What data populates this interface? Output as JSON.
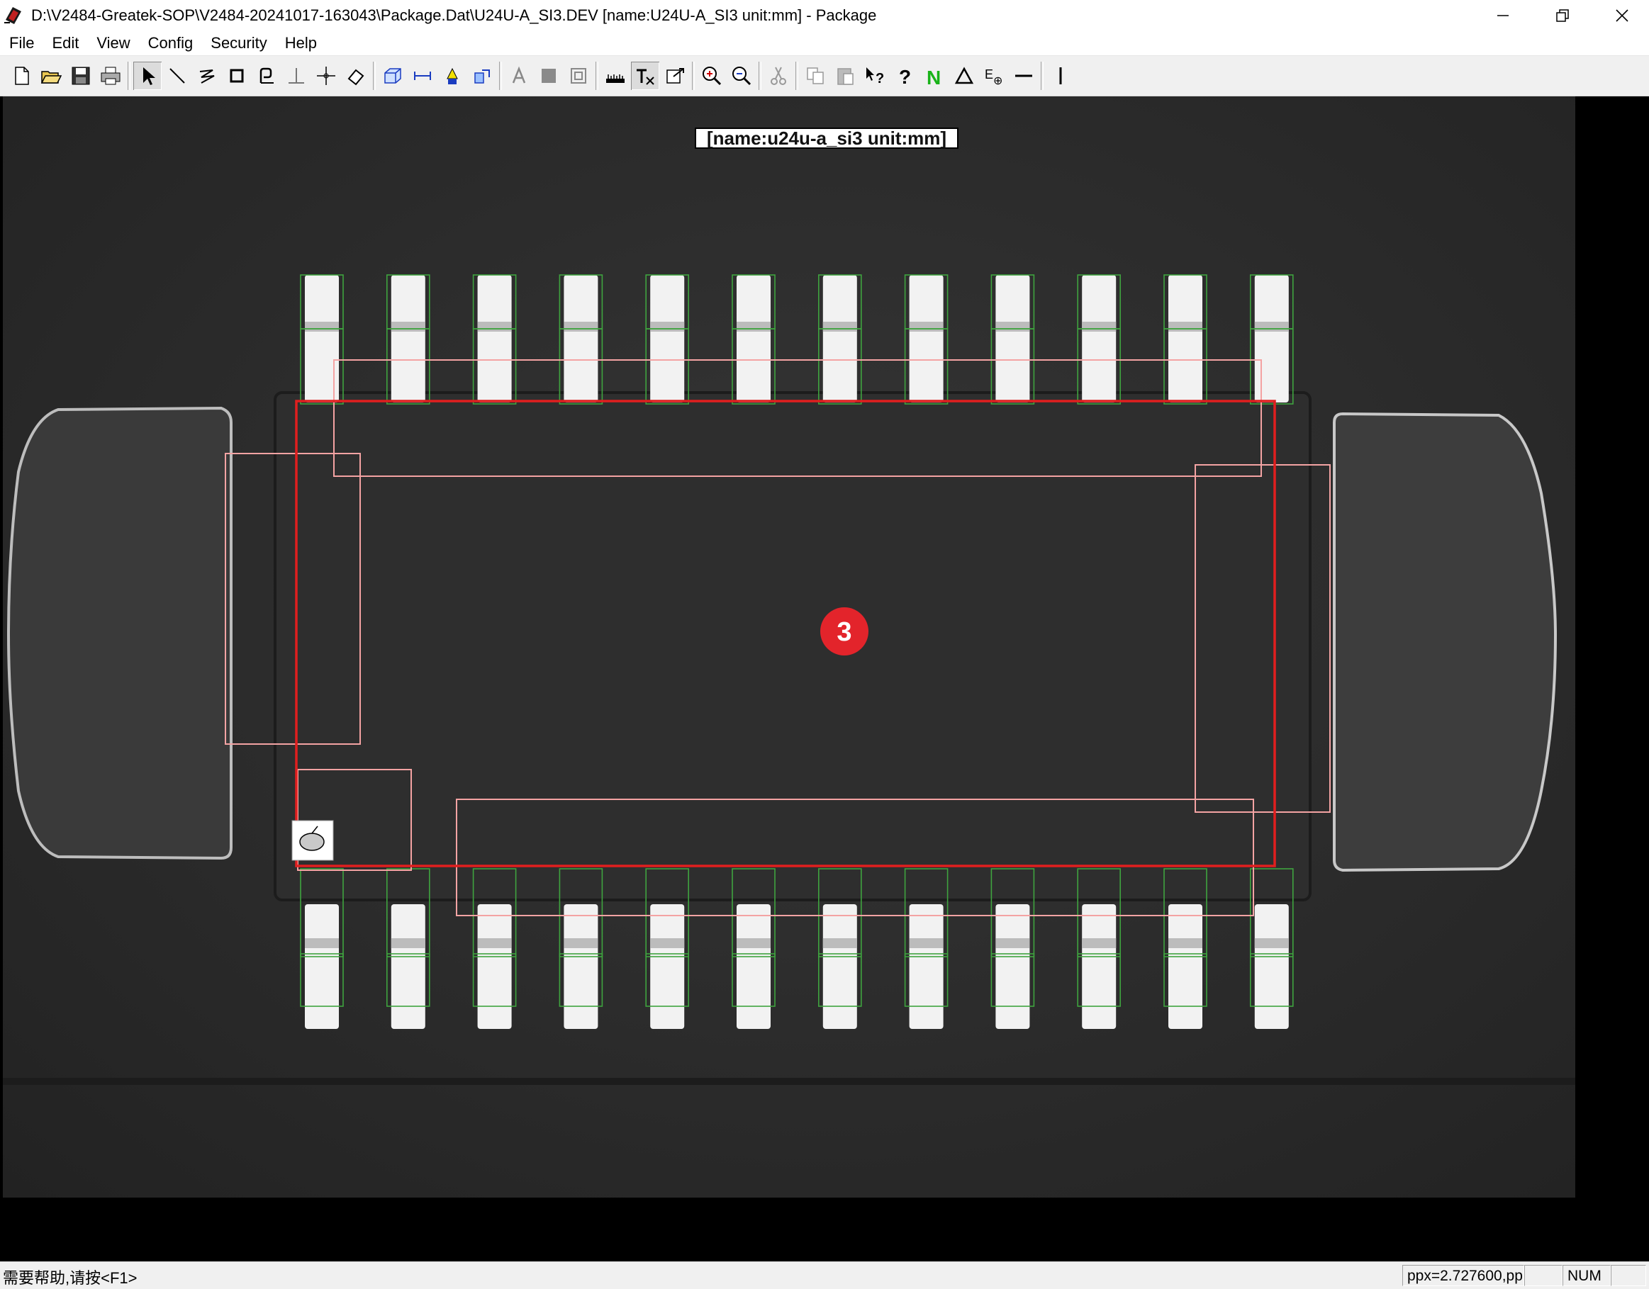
{
  "window": {
    "title": "D:\\V2484-Greatek-SOP\\V2484-20241017-163043\\Package.Dat\\U24U-A_SI3.DEV [name:U24U-A_SI3 unit:mm] - Package"
  },
  "menu": [
    "File",
    "Edit",
    "View",
    "Config",
    "Security",
    "Help"
  ],
  "toolbar": {
    "groups": [
      [
        "new-icon",
        "open-icon",
        "save-icon",
        "print-icon"
      ],
      [
        "pointer-icon",
        "line-icon",
        "polyline-icon",
        "rectangle-icon",
        "arc-icon",
        "perpendicular-icon",
        "crosshair-icon",
        "eraser-icon"
      ],
      [
        "box3d-icon",
        "dimension-icon",
        "marker-icon",
        "measure-icon"
      ],
      [
        "text-a-icon",
        "fill-icon",
        "grid-icon"
      ],
      [
        "ruler-icon",
        "text-tx-icon",
        "export-icon"
      ],
      [
        "zoom-in-icon",
        "zoom-out-icon"
      ],
      [
        "cut-icon"
      ],
      [
        "copy-icon",
        "paste-icon",
        "context-help-icon",
        "help-icon",
        "n-icon",
        "triangle-icon",
        "ep-icon",
        "horizontal-line-icon"
      ],
      [
        "vertical-line-icon"
      ]
    ]
  },
  "viewport": {
    "label": "[name:u24u-a_si3 unit:mm]",
    "marker_number": "3",
    "pins_per_side": 12,
    "colors": {
      "pin_roi": "#3fa33f",
      "body_roi": "#e01f1f",
      "sub_roi": "#f4a3a3",
      "marker": "#e3242b"
    }
  },
  "statusbar": {
    "help_text": "需要帮助,请按<F1>",
    "ppx": "ppx=2.727600,pp",
    "num": "NUM"
  }
}
